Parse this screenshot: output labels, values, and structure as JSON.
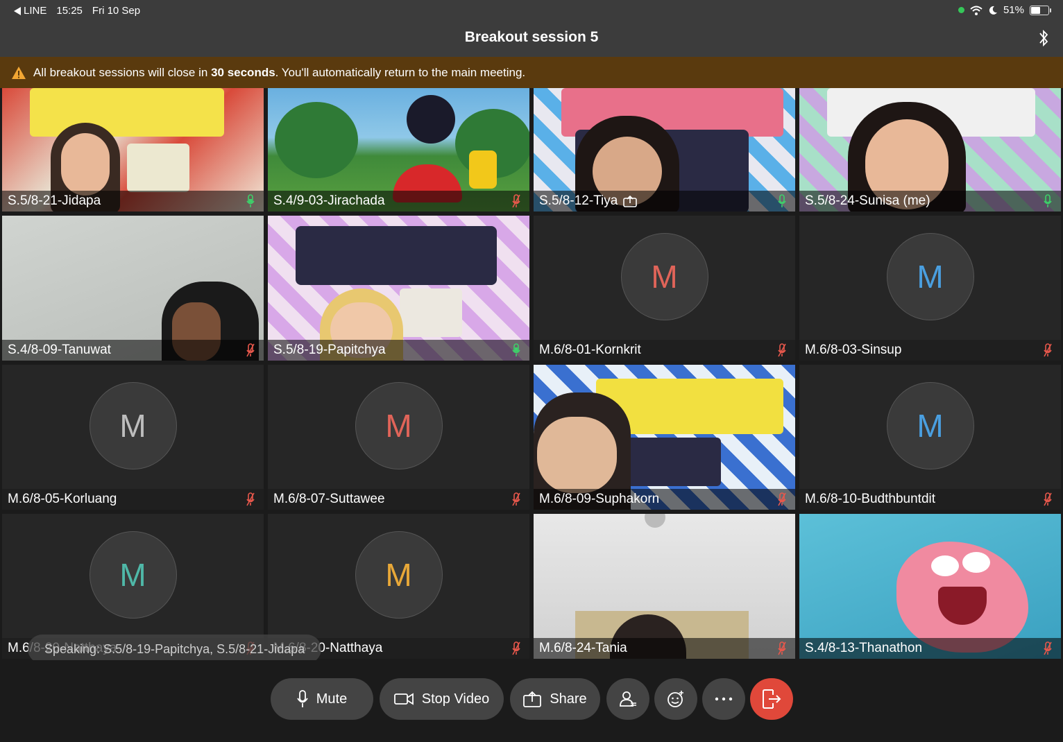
{
  "status_bar": {
    "back_app": "LINE",
    "time": "15:25",
    "date": "Fri 10 Sep",
    "battery": "51%",
    "battery_level": 0.51
  },
  "header": {
    "title": "Breakout session 5"
  },
  "banner": {
    "prefix": "All breakout sessions will close in ",
    "bold": "30 seconds",
    "suffix": ". You'll automatically return to the main meeting."
  },
  "participants": [
    {
      "name": "S.5/8-21-Jidapa",
      "mic": "on",
      "type": "video"
    },
    {
      "name": "S.4/9-03-Jirachada",
      "mic": "muted",
      "type": "video"
    },
    {
      "name": "S.5/8-12-Tiya",
      "mic": "on",
      "type": "video",
      "sharing": true
    },
    {
      "name": "S.5/8-24-Sunisa (me)",
      "mic": "on",
      "type": "video"
    },
    {
      "name": "S.4/8-09-Tanuwat",
      "mic": "muted",
      "type": "video"
    },
    {
      "name": "S.5/8-19-Papitchya",
      "mic": "on",
      "type": "video"
    },
    {
      "name": "M.6/8-01-Kornkrit",
      "mic": "muted",
      "type": "avatar",
      "initial": "M",
      "initial_color": "#e06459"
    },
    {
      "name": "M.6/8-03-Sinsup",
      "mic": "muted",
      "type": "avatar",
      "initial": "M",
      "initial_color": "#4a9fe0"
    },
    {
      "name": "M.6/8-05-Korluang",
      "mic": "muted",
      "type": "avatar",
      "initial": "M",
      "initial_color": "#bdbdbd"
    },
    {
      "name": "M.6/8-07-Suttawee",
      "mic": "muted",
      "type": "avatar",
      "initial": "M",
      "initial_color": "#e06459"
    },
    {
      "name": "M.6/8-09-Suphakorn",
      "mic": "muted",
      "type": "video"
    },
    {
      "name": "M.6/8-10-Budthbuntdit",
      "mic": "muted",
      "type": "avatar",
      "initial": "M",
      "initial_color": "#4a9fe0"
    },
    {
      "name": "M.6/8-20-Natthaya",
      "mic": "muted",
      "type": "avatar",
      "initial": "M",
      "initial_color": "#4fb8a8"
    },
    {
      "name": "M.6/8-20-Natthaya",
      "mic": "muted",
      "type": "avatar",
      "initial": "M",
      "initial_color": "#e8a838"
    },
    {
      "name": "M.6/8-24-Tania",
      "mic": "muted",
      "type": "video"
    },
    {
      "name": "S.4/8-13-Thanathon",
      "mic": "muted",
      "type": "video"
    }
  ],
  "speaking": "Speaking: S.5/8-19-Papitchya, S.5/8-21-Jidapa",
  "toolbar": {
    "mute_label": "Mute",
    "video_label": "Stop Video",
    "share_label": "Share",
    "participants_icon": "participants-icon",
    "reactions_icon": "reactions-icon",
    "more_icon": "more-icon",
    "leave_icon": "leave-icon"
  },
  "colors": {
    "mic_on": "#3ecf6a",
    "mic_muted": "#e8584c",
    "leave": "#e0483a",
    "banner_bg": "#5a3a0e"
  }
}
